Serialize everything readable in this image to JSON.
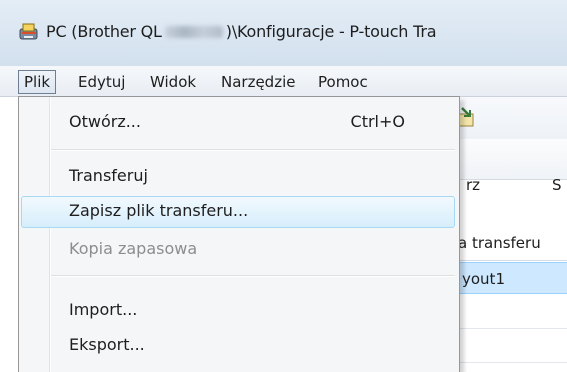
{
  "window": {
    "title_prefix": "PC (Brother QL",
    "title_suffix": ")\\Konfiguracje - P-touch Tra"
  },
  "menubar": {
    "items": [
      {
        "label": "Plik"
      },
      {
        "label": "Edytuj"
      },
      {
        "label": "Widok"
      },
      {
        "label": "Narzędzie"
      },
      {
        "label": "Pomoc"
      }
    ]
  },
  "file_menu": {
    "items": [
      {
        "label": "Otwórz...",
        "shortcut": "Ctrl+O"
      },
      {
        "label": "Transferuj"
      },
      {
        "label": "Zapisz plik transferu..."
      },
      {
        "label": "Kopia zapasowa"
      },
      {
        "label": "Import..."
      },
      {
        "label": "Eksport..."
      }
    ]
  },
  "background": {
    "toolbar_label_partial": "rz",
    "toolbar_label2_partial": "S",
    "column_header_partial": "a transferu",
    "selected_row_partial": "yout1"
  },
  "colors": {
    "selection": "#cde8ff",
    "menu_highlight": "#d6eefb",
    "disabled_text": "#8d8d8d"
  }
}
